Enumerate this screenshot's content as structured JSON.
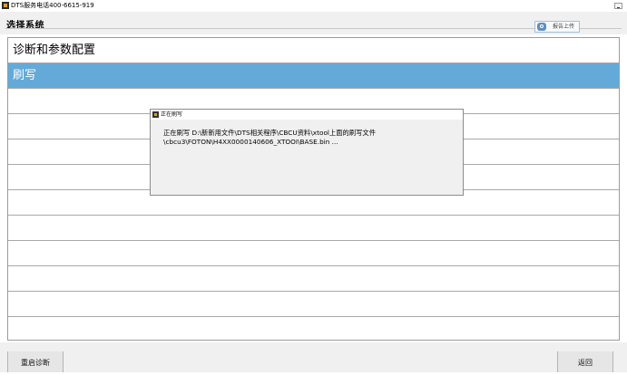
{
  "window": {
    "title": "DTS服务电话400-6615-919"
  },
  "header": {
    "title": "选择系统",
    "upload_label": "报告上传"
  },
  "list": {
    "items": [
      {
        "label": "诊断和参数配置",
        "selected": false
      },
      {
        "label": "刷写",
        "selected": true
      },
      {
        "label": ""
      },
      {
        "label": ""
      },
      {
        "label": ""
      },
      {
        "label": ""
      },
      {
        "label": ""
      },
      {
        "label": ""
      },
      {
        "label": ""
      },
      {
        "label": ""
      },
      {
        "label": ""
      },
      {
        "label": ""
      }
    ]
  },
  "dialog": {
    "title": "正在刷写",
    "message_line1": "正在刷写 D:\\新新用文件\\DTS相关程序\\CBCU资料\\xtool上面的刷写文件",
    "message_line2": "\\cbcu3\\FOTON\\H4XX0000140606_XTOOI\\BASE.bin ..."
  },
  "footer": {
    "restart_label": "重启诊断",
    "back_label": "返回"
  },
  "colors": {
    "selected_row": "#64aad8",
    "background": "#f0f0f0"
  }
}
